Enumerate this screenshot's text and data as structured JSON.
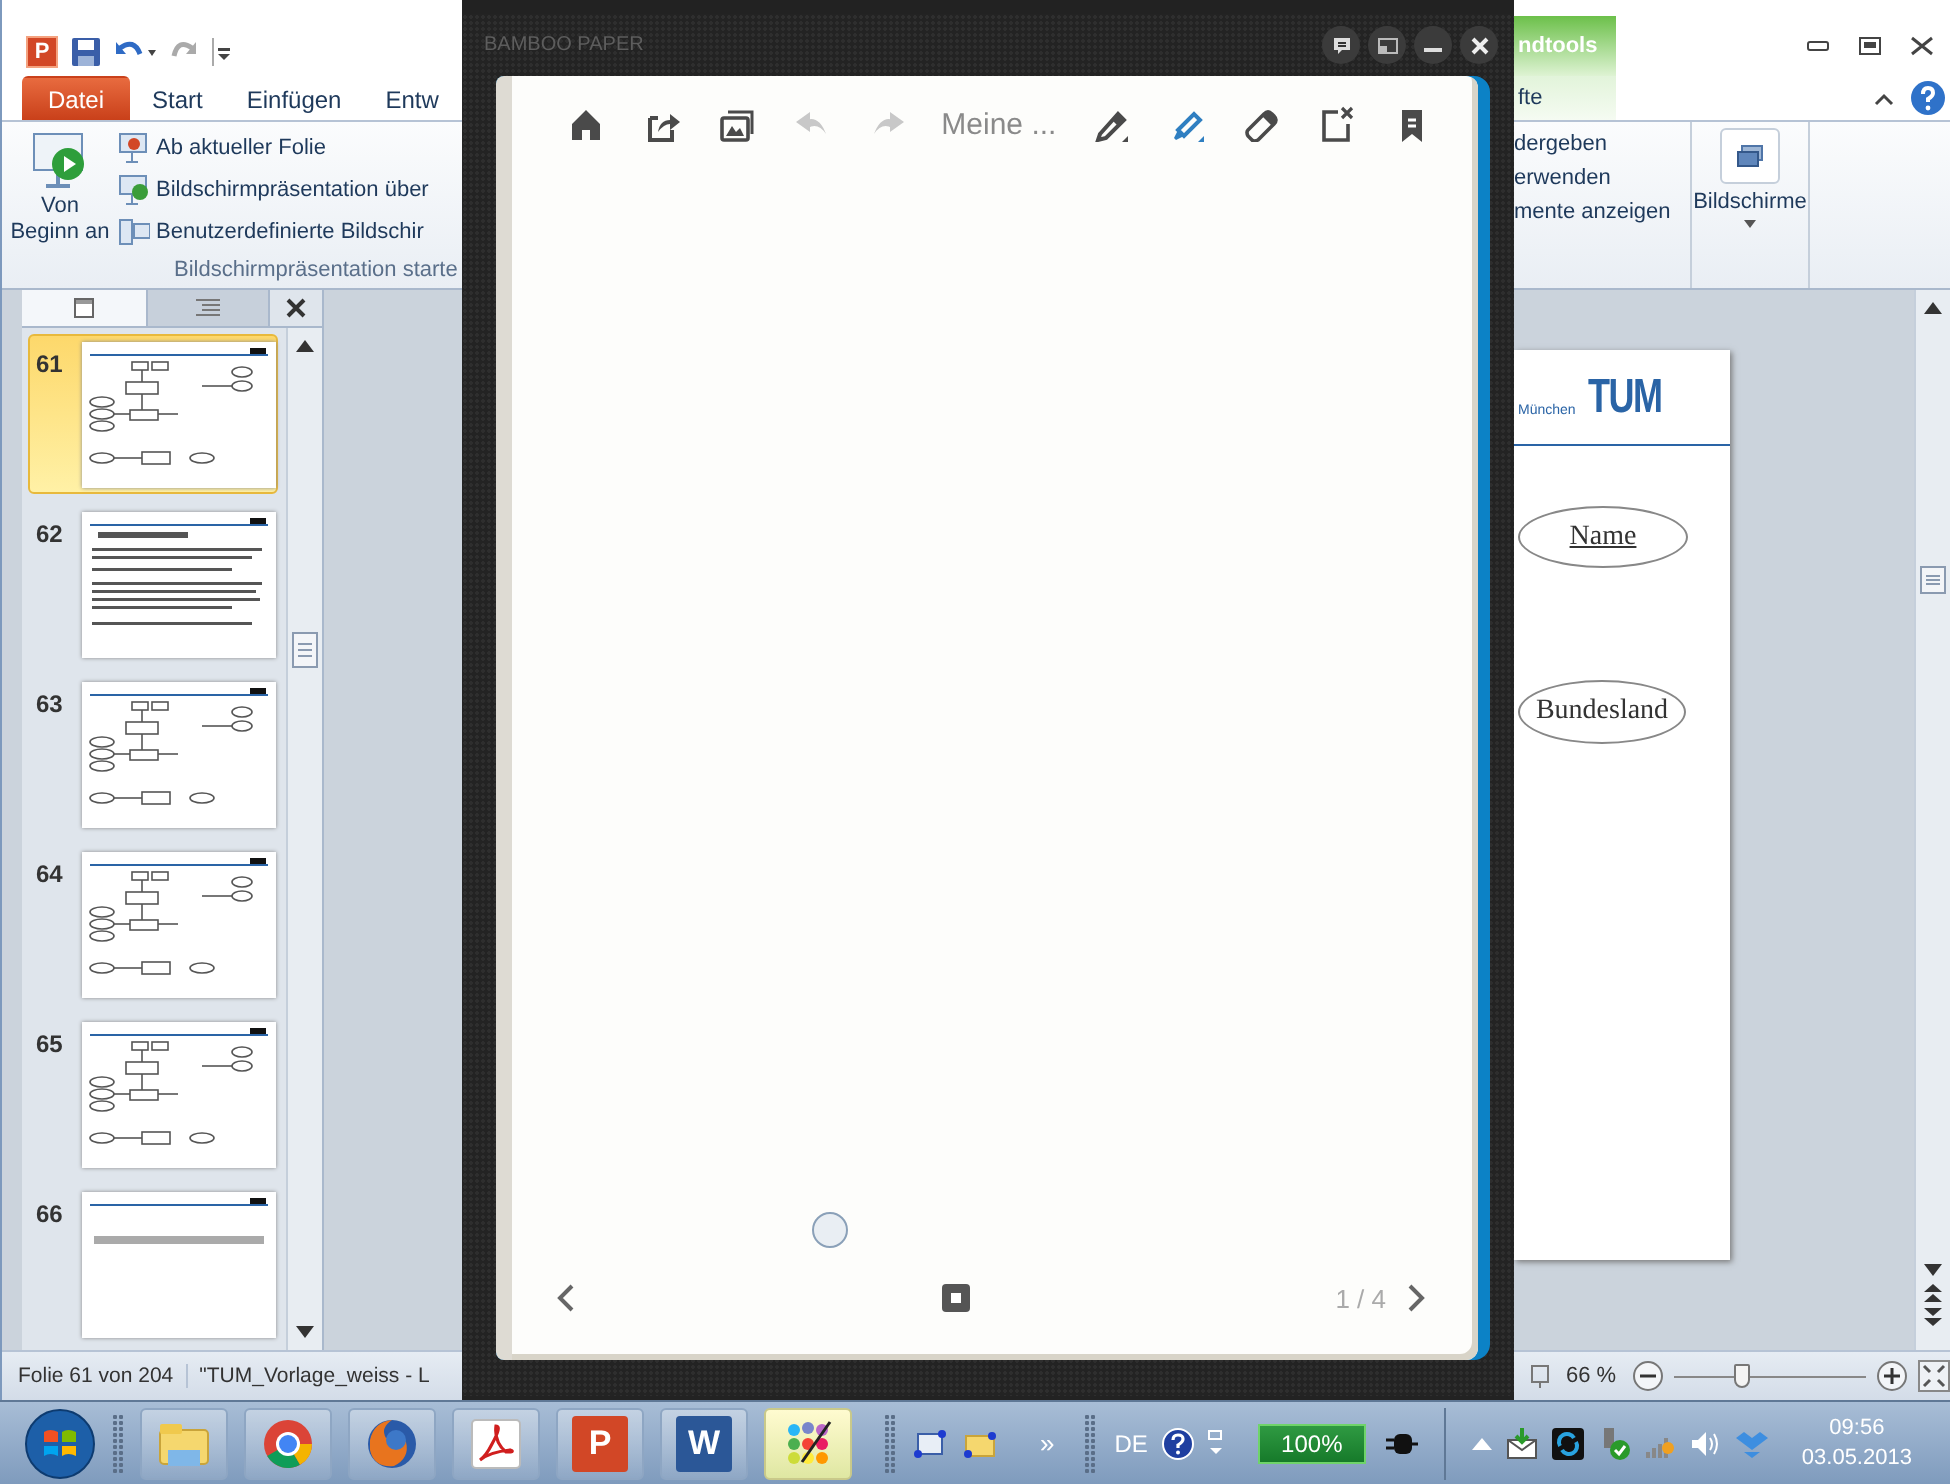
{
  "powerpoint": {
    "app_glyph": "P",
    "contextual_group": "ndtools",
    "tabs": [
      {
        "label": "Datei",
        "kind": "file",
        "selected": false
      },
      {
        "label": "Start",
        "kind": "tab",
        "selected": false
      },
      {
        "label": "Einfügen",
        "kind": "tab",
        "selected": false
      },
      {
        "label": "Entw",
        "kind": "tab",
        "selected": false
      }
    ],
    "contextual_tab": {
      "label": "fte",
      "selected": false
    },
    "ribbon": {
      "big_button": "Von Beginn an",
      "items": [
        "Ab aktueller Folie",
        "Bildschirmpräsentation über",
        "Benutzerdefinierte Bildschir"
      ],
      "group_caption": "Bildschirmpräsentation starte",
      "right_items": [
        "dergeben",
        "erwenden",
        "mente anzeigen"
      ],
      "monitors_button": "Bildschirme"
    },
    "slides": [
      {
        "number": "61",
        "kind": "diagram",
        "selected": true
      },
      {
        "number": "62",
        "kind": "text",
        "selected": false
      },
      {
        "number": "63",
        "kind": "diagram",
        "selected": false
      },
      {
        "number": "64",
        "kind": "diagram",
        "selected": false
      },
      {
        "number": "65",
        "kind": "diagram",
        "selected": false
      },
      {
        "number": "66",
        "kind": "title",
        "selected": false
      }
    ],
    "slide": {
      "header": "München",
      "logo": "TUM",
      "attributes": [
        {
          "label": "Name",
          "key": true
        },
        {
          "label": "Bundesland",
          "key": false
        }
      ]
    },
    "status_bar": {
      "slide_info": "Folie 61 von 204",
      "theme": "\"TUM_Vorlage_weiss - L",
      "zoom": "66 %",
      "zoom_slider": {
        "level": 0.35
      }
    }
  },
  "bamboo": {
    "title": "BAMBOO PAPER",
    "left_tools": [
      {
        "kind": "home",
        "disabled": false
      },
      {
        "kind": "share",
        "disabled": false
      },
      {
        "kind": "gallery",
        "disabled": false
      },
      {
        "kind": "undo",
        "disabled": true
      },
      {
        "kind": "redo",
        "disabled": true
      }
    ],
    "notebook_title": "Meine ...",
    "right_tools": [
      {
        "kind": "pen",
        "selected": false
      },
      {
        "kind": "highlighter",
        "selected": true
      },
      {
        "kind": "eraser",
        "selected": false
      },
      {
        "kind": "clear",
        "selected": false
      },
      {
        "kind": "bookmark",
        "selected": false
      }
    ],
    "page": "1 / 4"
  },
  "taskbar": {
    "apps": [
      {
        "kind": "explorer",
        "selected": false
      },
      {
        "kind": "chrome",
        "selected": false
      },
      {
        "kind": "firefox",
        "selected": false
      },
      {
        "kind": "acrobat",
        "selected": false
      },
      {
        "kind": "powerpoint",
        "glyph": "P",
        "selected": false
      },
      {
        "kind": "word",
        "glyph": "W",
        "selected": false
      },
      {
        "kind": "paint",
        "selected": true
      }
    ],
    "overflow": "»",
    "language": "DE",
    "battery": "100%",
    "time": "09:56",
    "date": "03.05.2013"
  }
}
